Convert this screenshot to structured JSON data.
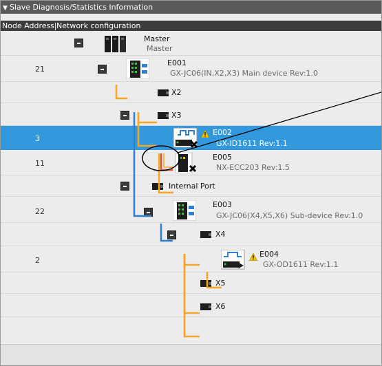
{
  "panel": {
    "title": "Slave Diagnosis/Statistics Information",
    "title_icon": "triangle-down-icon"
  },
  "columns": {
    "node_address": "Node Address",
    "network_configuration": "Network configuration"
  },
  "tree": {
    "master": {
      "name": "Master",
      "sub": "Master",
      "address": ""
    },
    "e001": {
      "address": "21",
      "name": "E001",
      "sub": "GX-JC06(IN,X2,X3) Main device Rev:1.0"
    },
    "x2": {
      "name": "X2"
    },
    "x3": {
      "name": "X3"
    },
    "e002": {
      "address": "3",
      "name": "E002",
      "sub": "GX-ID1611 Rev:1.1",
      "warning": true
    },
    "e005": {
      "address": "11",
      "name": "E005",
      "sub": "NX-ECC203 Rev:1.5"
    },
    "internal_port": {
      "name": "Internal Port"
    },
    "e003": {
      "address": "22",
      "name": "E003",
      "sub": "GX-JC06(X4,X5,X6) Sub-device Rev:1.0"
    },
    "x4": {
      "name": "X4"
    },
    "e004": {
      "address": "2",
      "name": "E004",
      "sub": "GX-OD1611 Rev:1.1",
      "warning": true
    },
    "x5": {
      "name": "X5"
    },
    "x6": {
      "name": "X6"
    }
  },
  "colors": {
    "selected_row": "#3399dd",
    "cable_orange": "#f5a623",
    "cable_blue": "#2f7fd0",
    "cable_red": "#e0502a",
    "header_bg": "#3c3c3c"
  }
}
